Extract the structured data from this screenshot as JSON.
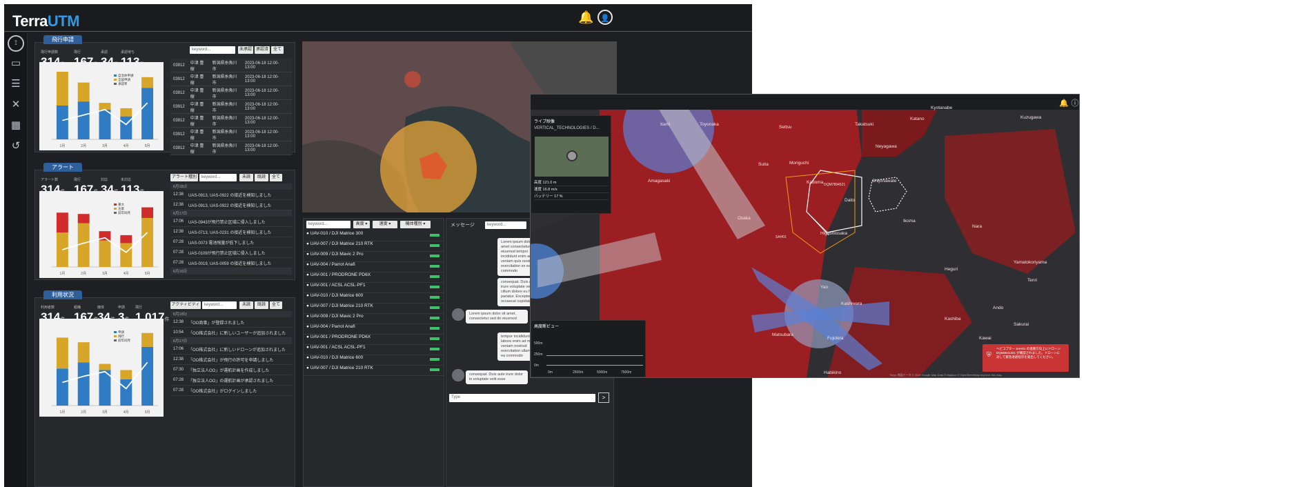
{
  "app": {
    "logo_a": "Terra",
    "logo_b": "UTM"
  },
  "header": {
    "bell_icon": "bell-icon",
    "user_icon": "user-circle-icon"
  },
  "sidebar": [
    "dashboard-icon",
    "monitor-icon",
    "list-icon",
    "drone-icon",
    "building-icon",
    "history-icon"
  ],
  "panels": [
    {
      "tab": "飛行申請",
      "stats": [
        {
          "label": "飛行申請数",
          "value": "314",
          "unit": "件"
        },
        {
          "label": "飛行",
          "value": "167",
          "unit": "件"
        },
        {
          "label": "承認",
          "value": "34",
          "unit": "件"
        },
        {
          "label": "承認待ち",
          "value": "113",
          "unit": "件"
        }
      ],
      "search_placeholder": "keyword...",
      "filters": [
        "未承認",
        "承認済",
        "全て"
      ]
    },
    {
      "tab": "アラート",
      "stats": [
        {
          "label": "アラート数",
          "value": "314",
          "unit": "件"
        },
        {
          "label": "飛行",
          "value": "167",
          "unit": "件"
        },
        {
          "label": "対応",
          "value": "34",
          "unit": "件"
        },
        {
          "label": "未対応",
          "value": "113",
          "unit": "件"
        }
      ],
      "search_placeholder": "keyword...",
      "select": "アラート種別 ▾",
      "filters": [
        "未読",
        "既読",
        "全て"
      ]
    },
    {
      "tab": "利用状況",
      "stats": [
        {
          "label": "利用者数",
          "value": "314",
          "unit": "件"
        },
        {
          "label": "組織",
          "value": "167",
          "unit": "件"
        },
        {
          "label": "機体",
          "value": "34",
          "unit": "件"
        },
        {
          "label": "申請",
          "value": "3",
          "unit": "件"
        },
        {
          "label": "飛行",
          "value": "1,017",
          "unit": "件"
        }
      ],
      "search_placeholder": "keyword...",
      "select": "アクティビティ ▾",
      "filters": [
        "未読",
        "既読",
        "全て"
      ]
    }
  ],
  "flight_rows": [
    {
      "id": "03912",
      "name": "中津 豊樹",
      "area": "新潟県糸魚川市",
      "date": "2023-06-18 12:00-13:00"
    },
    {
      "id": "03912",
      "name": "中津 豊樹",
      "area": "新潟県糸魚川市",
      "date": "2023-06-18 12:00-13:00"
    },
    {
      "id": "03912",
      "name": "中津 豊樹",
      "area": "新潟県糸魚川市",
      "date": "2023-06-18 12:00-13:00"
    },
    {
      "id": "03912",
      "name": "中津 豊樹",
      "area": "新潟県糸魚川市",
      "date": "2023-06-18 12:00-13:00"
    },
    {
      "id": "03912",
      "name": "中津 豊樹",
      "area": "新潟県糸魚川市",
      "date": "2023-06-18 12:00-13:00"
    },
    {
      "id": "03912",
      "name": "中津 豊樹",
      "area": "新潟県糸魚川市",
      "date": "2023-06-18 12:00-13:00"
    },
    {
      "id": "03912",
      "name": "中津 豊樹",
      "area": "新潟県糸魚川市",
      "date": "2023-06-18 12:00-13:00"
    }
  ],
  "alert_rows": [
    {
      "date": "6月18日"
    },
    {
      "time": "12:38",
      "text": "UAS-0913, UAS-0922 の接近を検知しました"
    },
    {
      "time": "12:38",
      "text": "UAS-0913, UAS-0922 の接近を検知しました"
    },
    {
      "date": "6月17日"
    },
    {
      "time": "17:06",
      "text": "UAS-0943が飛行禁止区域に侵入しました"
    },
    {
      "time": "12:38",
      "text": "UAS-0713, UAS-0231 の接近を検知しました"
    },
    {
      "time": "07:28",
      "text": "UAS-0073 電池残量が低下しました"
    },
    {
      "time": "07:28",
      "text": "UAS-0109が飛行禁止区域に侵入しました"
    },
    {
      "time": "07:28",
      "text": "UAS-0019, UAS-0059 の接近を検知しました"
    },
    {
      "date": "6月16日"
    }
  ],
  "activity_rows": [
    {
      "date": "6月18日"
    },
    {
      "time": "12:38",
      "text": "「OO商事」が登録されました"
    },
    {
      "time": "10:54",
      "text": "「OO株式会社」に新しいユーザーが追加されました"
    },
    {
      "date": "6月17日"
    },
    {
      "time": "17:06",
      "text": "「OO株式会社」に新しいドローンが追加されました"
    },
    {
      "time": "12:38",
      "text": "「OO株式会社」が飛行の許可を申請しました"
    },
    {
      "time": "07:30",
      "text": "「独立法人OO」が運航計画を作成しました"
    },
    {
      "time": "07:28",
      "text": "「独立法人OO」の運航計画が承認されました"
    },
    {
      "time": "07:28",
      "text": "「OO株式会社」がログインしました"
    }
  ],
  "uav_filters": {
    "search": "keyword...",
    "sel1": "高度 ▾",
    "sel2": "速度 ▾",
    "sel3": "機体種別 ▾"
  },
  "uavs": [
    "UAV-010 / DJI Matrice 300",
    "UAV-007 / DJI Matrice 210 RTK",
    "UAV-009 / DJI Mavic 2 Pro",
    "UAV-004 / Parrot Anafi",
    "UAV-001 / PRODRONE PD6X",
    "UAV-001 / ACSL ACSL-PF1",
    "UAV-010 / DJI Matrice 600",
    "UAV-007 / DJI Matrice 210 RTK",
    "UAV-009 / DJI Mavic 2 Pro",
    "UAV-004 / Parrot Anafi",
    "UAV-001 / PRODRONE PD6X",
    "UAV-001 / ACSL ACSL-PF1",
    "UAV-010 / DJI Matrice 600",
    "UAV-007 / DJI Matrice 210 RTK"
  ],
  "messages": {
    "title": "メッセージ",
    "search": "keyword...",
    "input": "Type",
    "bubbles": [
      "Lorem ipsum dolor sit amet consectetur sed do eiusmod tempor incididunt enim ad minim veniam quis nostrud exercitation ex ea commodo",
      "consequat. Duis aute irure voluptate velit esse cillum dolore eu fugiat pariatur. Excepteur sint occaecat cupidatat",
      "Lorem ipsum dolor sit amet, consectetur sed do eiusmod",
      "tempor incididunt ut labore enim ad minim veniam nostrud exercitation ullamco ex ea commodo",
      "consequat. Duis aute irure dolor in voluptate velit esse"
    ]
  },
  "right_map": {
    "live_title": "ライブ映像",
    "live_name": "VERTICAL_TECHNOLOGIES / D...",
    "telemetry": [
      {
        "k": "高度",
        "v": "121.0 m"
      },
      {
        "k": "速度",
        "v": "16.8 m/s"
      },
      {
        "k": "バッテリー",
        "v": "17 %"
      }
    ],
    "alt_title": "高度断ビュー",
    "alt_ticks": [
      "500m",
      "250m",
      "0m"
    ],
    "alt_x": [
      "0m",
      "2500m",
      "5000m",
      "7500m"
    ],
    "cities": [
      "Itami",
      "Toyonaka",
      "Settsu",
      "Takatsuki",
      "Kyotanabe",
      "Kuzugawa",
      "Neyagawa",
      "Katano",
      "Suita",
      "Moriguchi",
      "Amagasaki",
      "Kadoma",
      "Daito",
      "Shijonawate",
      "Osaka",
      "Higashiosaka",
      "Ikoma",
      "Nara",
      "Yao",
      "Kashiwara",
      "Fujidera",
      "Matsubara",
      "Habikino",
      "Heguri",
      "Yamatokoriyama",
      "Tenri",
      "Ando",
      "Sakurai",
      "Kawai",
      "Kashiba"
    ],
    "drone_label1": "DQM7894521",
    "drone_label2": "SAH01",
    "toast": "ヘビコプター SAH01 の進路方向上にドローン DQM5641321 が確認されました。ドローンに対して緊急退避指示を発出してください。",
    "footer": "Tokyo 地図データ © 2019 Google Map Data © Mapbox © OpenStreetMap Improve this map"
  },
  "chart_data": [
    {
      "type": "bar",
      "title": "",
      "categories": [
        "1月",
        "2月",
        "3月",
        "4月",
        "5月"
      ],
      "legend": [
        "自治体申請",
        "全国申請",
        "承認率"
      ],
      "series": [
        {
          "name": "自治体申請",
          "values": [
            25,
            28,
            22,
            17,
            38
          ],
          "color": "#2f7cc4"
        },
        {
          "name": "全国申請",
          "values": [
            25,
            14,
            5,
            6,
            8
          ],
          "color": "#d7a528"
        },
        {
          "name": "承認率",
          "values": [
            14,
            18,
            22,
            11,
            27
          ],
          "color": "#ffffff",
          "kind": "line"
        }
      ],
      "ylim": [
        0,
        50
      ]
    },
    {
      "type": "bar",
      "title": "",
      "categories": [
        "1月",
        "2月",
        "3月",
        "4月",
        "5月"
      ],
      "legend": [
        "重大",
        "注意",
        "前年同月"
      ],
      "series": [
        {
          "name": "注意",
          "values": [
            26,
            33,
            20,
            18,
            37
          ],
          "color": "#d7a528"
        },
        {
          "name": "重大",
          "values": [
            15,
            7,
            7,
            6,
            8
          ],
          "color": "#d22b2b"
        },
        {
          "name": "前年同月",
          "values": [
            13,
            18,
            22,
            11,
            26
          ],
          "color": "#ffffff",
          "kind": "line"
        }
      ],
      "ylim": [
        0,
        50
      ]
    },
    {
      "type": "bar",
      "title": "",
      "categories": [
        "1月",
        "2月",
        "3月",
        "4月",
        "5月"
      ],
      "legend": [
        "申請",
        "飛行",
        "前年同月"
      ],
      "series": [
        {
          "name": "申請",
          "values": [
            24,
            28,
            23,
            17,
            38
          ],
          "color": "#2f7cc4"
        },
        {
          "name": "飛行",
          "values": [
            20,
            13,
            4,
            6,
            9
          ],
          "color": "#d7a528"
        },
        {
          "name": "前年同月",
          "values": [
            15,
            19,
            22,
            11,
            28
          ],
          "color": "#ffffff",
          "kind": "line"
        }
      ],
      "ylim": [
        0,
        50
      ]
    }
  ]
}
